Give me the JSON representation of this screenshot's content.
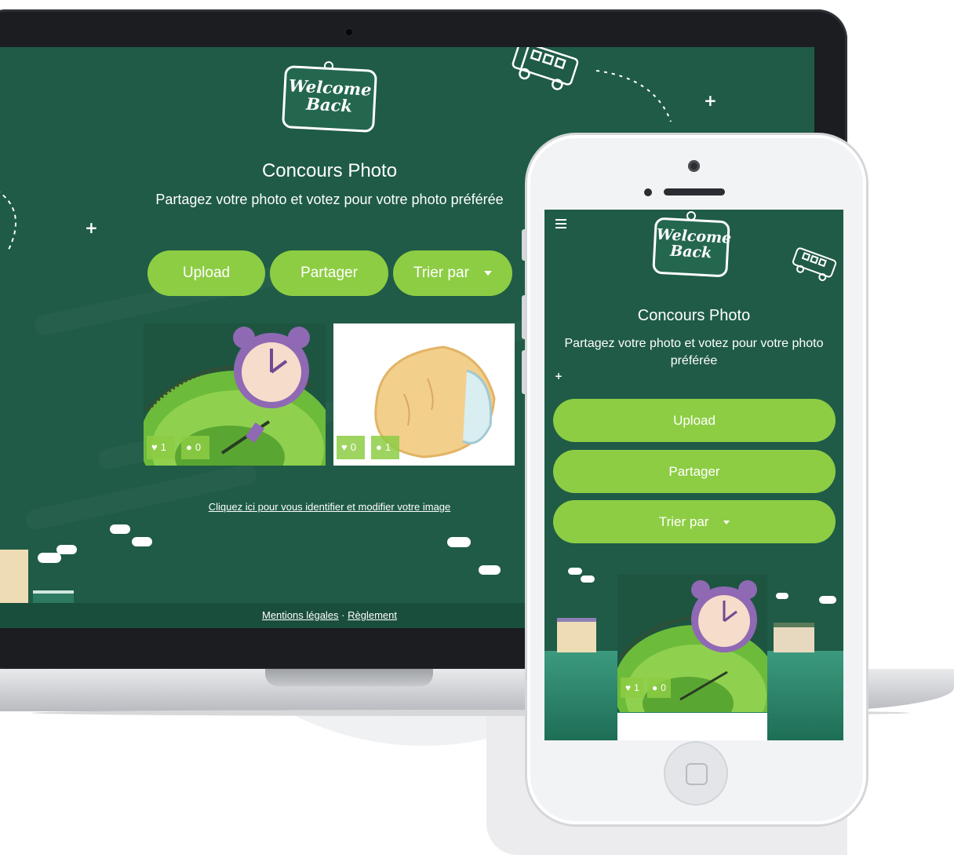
{
  "logo": {
    "line1": "Welcome",
    "line2": "Back"
  },
  "desktop": {
    "title": "Concours Photo",
    "subtitle": "Partagez votre photo et votez pour votre photo préférée",
    "buttons": {
      "upload": "Upload",
      "share": "Partager",
      "sort": "Trier par"
    },
    "photos": [
      {
        "likes": "1",
        "comments": "0"
      },
      {
        "likes": "0",
        "comments": "1"
      }
    ],
    "login_link": "Cliquez ici pour vous identifier et modifier votre image",
    "footer": {
      "legal": "Mentions légales",
      "separator": "·",
      "rules": "Règlement"
    }
  },
  "mobile": {
    "title": "Concours Photo",
    "subtitle": "Partagez votre photo et votez pour votre photo préférée",
    "buttons": {
      "upload": "Upload",
      "share": "Partager",
      "sort": "Trier par"
    },
    "photo": {
      "likes": "1",
      "comments": "0"
    }
  },
  "colors": {
    "chalkboard": "#1f5b46",
    "accent_green": "#8dcd44",
    "text": "#ffffff"
  },
  "icons": {
    "menu": "hamburger-icon",
    "like": "heart-icon",
    "comment": "speech-bubble-icon",
    "sort": "caret-down-icon",
    "decor": "school-bus-icon"
  }
}
